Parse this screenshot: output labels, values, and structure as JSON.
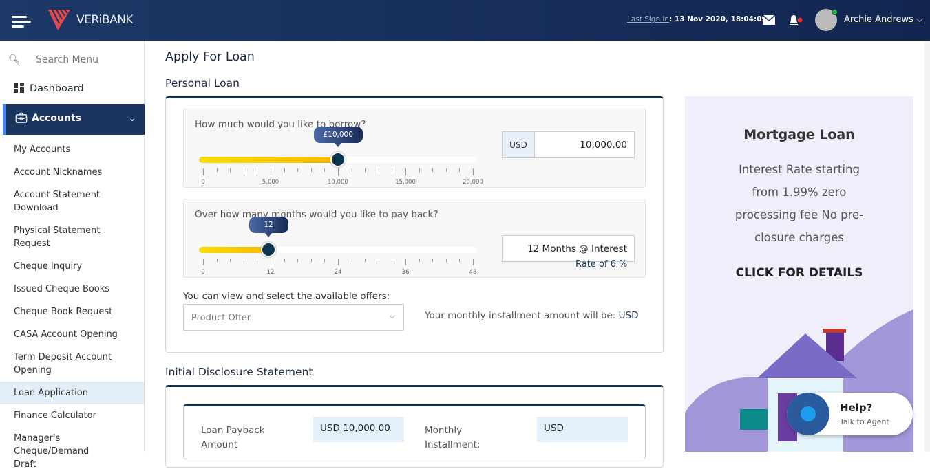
{
  "header": {
    "brand": "VERiBANK",
    "last_sign_label": "Last Sign in",
    "last_sign_value": ": 13 Nov 2020, 18:04:09",
    "user_name": "Archie Andrews",
    "icons": [
      "menu-icon",
      "mail-icon",
      "bell-icon",
      "chevron-down-icon"
    ]
  },
  "sidebar": {
    "search_placeholder": "Search Menu",
    "dashboard": "Dashboard",
    "accounts": "Accounts",
    "items": [
      {
        "label": "My Accounts"
      },
      {
        "label": "Account Nicknames"
      },
      {
        "label": "Account Statement Download"
      },
      {
        "label": "Physical Statement Request"
      },
      {
        "label": "Cheque Inquiry"
      },
      {
        "label": "Issued Cheque Books"
      },
      {
        "label": "Cheque Book Request"
      },
      {
        "label": "CASA Account Opening"
      },
      {
        "label": "Term Deposit Account Opening"
      },
      {
        "label": "Loan Application"
      },
      {
        "label": "Finance Calculator"
      },
      {
        "label": "Manager's Cheque/Demand Draft"
      }
    ],
    "active_item": "Loan Application"
  },
  "page": {
    "title": "Apply For Loan",
    "section": "Personal Loan",
    "disclosure_title": "Initial Disclosure Statement"
  },
  "borrow": {
    "question": "How much would you like to borrow?",
    "tooltip": "£10,000",
    "value": 10000,
    "min": 0,
    "max": 20000,
    "tick_labels": [
      "0",
      "5,000",
      "10,000",
      "15,000",
      "20,000"
    ],
    "currency": "USD",
    "amount": "10,000.00"
  },
  "months": {
    "question": "Over how many months would you like to pay back?",
    "tooltip": "12",
    "value": 12,
    "min": 0,
    "max": 48,
    "tick_labels": [
      "0",
      "12",
      "24",
      "36",
      "48"
    ],
    "field_value": "12 Months @ Interest",
    "rate_text": "Rate of 6 %"
  },
  "offers": {
    "label": "You can view and select the available offers:",
    "placeholder": "Product Offer",
    "installment_text": "Your monthly installment amount will be:",
    "installment_currency": "USD"
  },
  "disclosure": {
    "payback_label": "Loan Payback Amount",
    "payback_value": "USD 10,000.00",
    "monthly_label": "Monthly Installment:",
    "monthly_value": "USD"
  },
  "ad": {
    "title": "Mortgage Loan",
    "desc": "Interest Rate starting from 1.99% zero processing fee No pre-closure charges",
    "cta": "CLICK FOR DETAILS"
  },
  "help": {
    "title": "Help?",
    "subtitle": "Talk to Agent"
  },
  "colors": {
    "header": "#1b3561",
    "accent": "#f6c800",
    "knob": "#0c3550"
  }
}
